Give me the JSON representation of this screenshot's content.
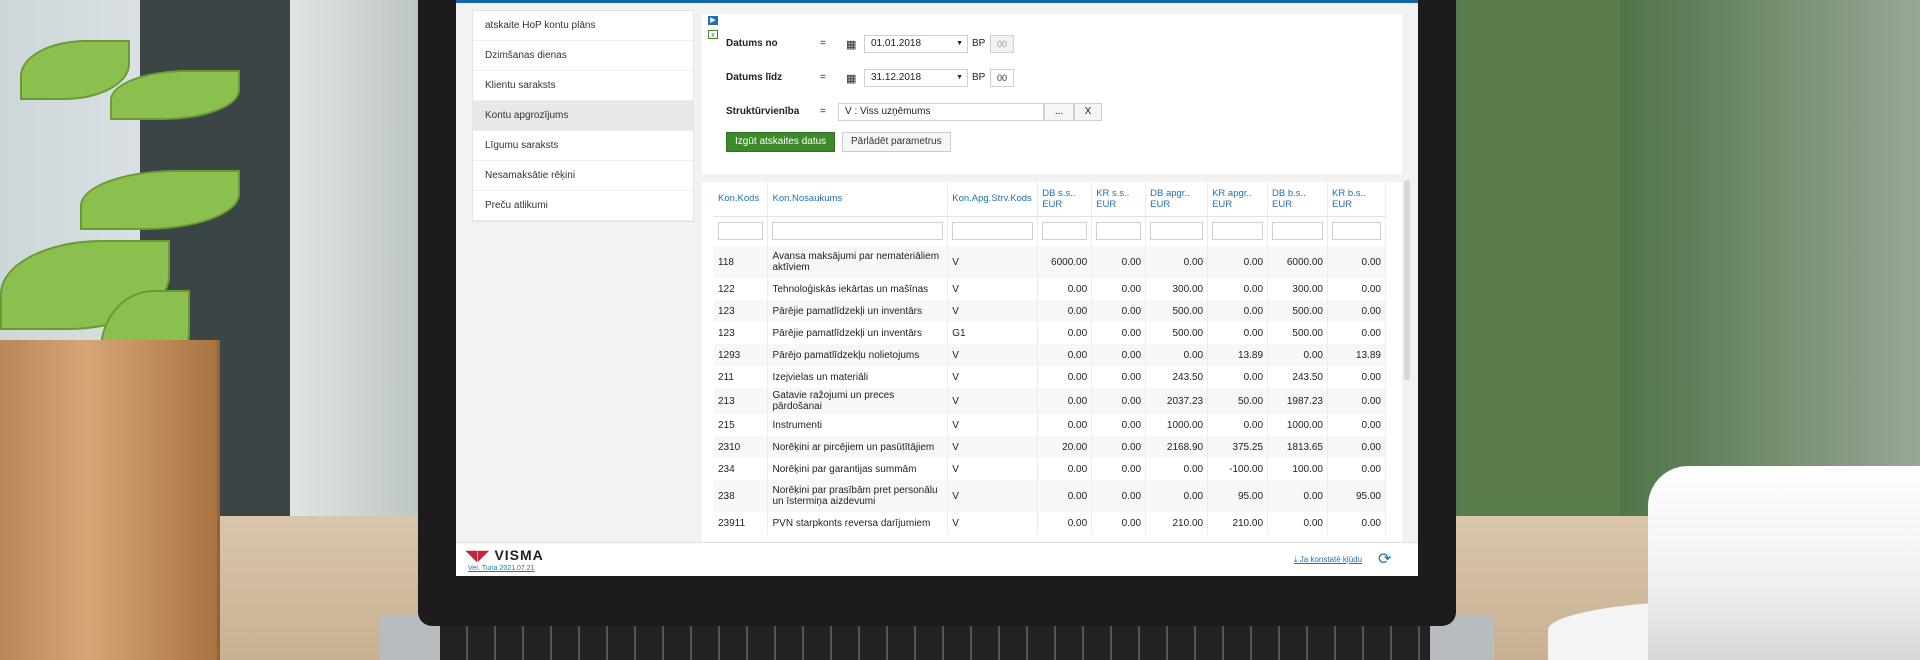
{
  "sidebar": {
    "items": [
      {
        "label": "atskaite HoP kontu plāns"
      },
      {
        "label": "Dzimšanas dienas"
      },
      {
        "label": "Klientu saraksts"
      },
      {
        "label": "Kontu apgrozījums"
      },
      {
        "label": "Līgumu saraksts"
      },
      {
        "label": "Nesamaksātie rēķini"
      },
      {
        "label": "Preču atlikumi"
      }
    ]
  },
  "params": {
    "date_from": {
      "label": "Datums no",
      "eq": "=",
      "value": "01.01.2018",
      "bp": "BP",
      "code": "00"
    },
    "date_to": {
      "label": "Datums līdz",
      "eq": "=",
      "value": "31.12.2018",
      "bp": "BP",
      "code": "00"
    },
    "unit": {
      "label": "Struktūrvienība",
      "eq": "=",
      "value": "V : Viss uzņēmums",
      "browse": "...",
      "clear": "X"
    },
    "run_button": "Izgūt atskaites datus",
    "reload_button": "Pārlādēt parametrus"
  },
  "grid": {
    "columns": [
      "Kon.Kods",
      "Kon.Nosaukums",
      "Kon.Apg.Strv.Kods",
      "DB s.s.. EUR",
      "KR s.s.. EUR",
      "DB apgr.. EUR",
      "KR apgr.. EUR",
      "DB b.s.. EUR",
      "KR b.s.. EUR"
    ],
    "rows": [
      [
        "118",
        "Avansa maksājumi par nemateriāliem aktīviem",
        "V",
        "6000.00",
        "0.00",
        "0.00",
        "0.00",
        "6000.00",
        "0.00"
      ],
      [
        "122",
        "Tehnoloģiskās iekārtas un mašīnas",
        "V",
        "0.00",
        "0.00",
        "300.00",
        "0.00",
        "300.00",
        "0.00"
      ],
      [
        "123",
        "Pārējie pamatlīdzekļi un inventārs",
        "V",
        "0.00",
        "0.00",
        "500.00",
        "0.00",
        "500.00",
        "0.00"
      ],
      [
        "123",
        "Pārējie pamatlīdzekļi un inventārs",
        "G1",
        "0.00",
        "0.00",
        "500.00",
        "0.00",
        "500.00",
        "0.00"
      ],
      [
        "1293",
        "Pārējo pamatlīdzekļu nolietojums",
        "V",
        "0.00",
        "0.00",
        "0.00",
        "13.89",
        "0.00",
        "13.89"
      ],
      [
        "211",
        "Izejvielas un materiāli",
        "V",
        "0.00",
        "0.00",
        "243.50",
        "0.00",
        "243.50",
        "0.00"
      ],
      [
        "213",
        "Gatavie ražojumi un preces pārdošanai",
        "V",
        "0.00",
        "0.00",
        "2037.23",
        "50.00",
        "1987.23",
        "0.00"
      ],
      [
        "215",
        "Instrumenti",
        "V",
        "0.00",
        "0.00",
        "1000.00",
        "0.00",
        "1000.00",
        "0.00"
      ],
      [
        "2310",
        "Norēķini ar pircējiem un pasūtītājiem",
        "V",
        "20.00",
        "0.00",
        "2168.90",
        "375.25",
        "1813.65",
        "0.00"
      ],
      [
        "234",
        "Norēķini par garantijas summām",
        "V",
        "0.00",
        "0.00",
        "0.00",
        "-100.00",
        "100.00",
        "0.00"
      ],
      [
        "238",
        "Norēķini par prasībām pret personālu un īstermiņa aizdevumi",
        "V",
        "0.00",
        "0.00",
        "0.00",
        "95.00",
        "0.00",
        "95.00"
      ],
      [
        "23911",
        "PVN starpkonts reversa darījumiem",
        "V",
        "0.00",
        "0.00",
        "210.00",
        "210.00",
        "0.00",
        "0.00"
      ]
    ]
  },
  "footer": {
    "brand": "VISMA",
    "version": "Ver. Tuna 2021.07.21",
    "link": "Ja konstatē kļūdu"
  },
  "colors": {
    "accent": "#1f70b5",
    "run_button": "#3c8a29",
    "brand_mark": "#c4263c"
  },
  "icons": [
    "calendar-icon",
    "dropdown-arrow-icon",
    "refresh-icon",
    "download-icon",
    "excel-icon"
  ]
}
